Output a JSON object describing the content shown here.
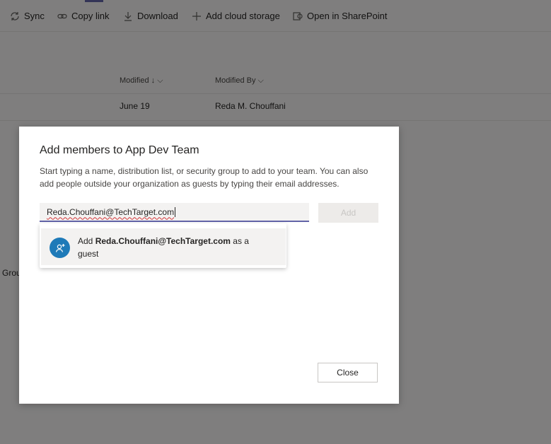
{
  "toolbar": {
    "sync": "Sync",
    "copy_link": "Copy link",
    "download": "Download",
    "add_cloud_storage": "Add cloud storage",
    "open_in_sharepoint": "Open in SharePoint"
  },
  "table": {
    "columns": [
      "Modified ↓ ⌵",
      "Modified By ⌵"
    ],
    "rows": [
      [
        "June 19",
        "Reda M. Chouffani"
      ]
    ]
  },
  "side_text": "Grou",
  "dialog": {
    "title": "Add members to App Dev Team",
    "description": "Start typing a name, distribution list, or security group to add to your team. You can also add people outside your organization as guests by typing their email addresses.",
    "input_value": "Reda.Chouffani@TechTarget.com",
    "add_button": "Add",
    "suggestion": {
      "prefix": "Add ",
      "email": "Reda.Chouffani@TechTarget.com",
      "suffix": " as a guest"
    },
    "close_button": "Close"
  },
  "colors": {
    "accent": "#6264a7",
    "guest_icon": "#1e7ab8"
  }
}
